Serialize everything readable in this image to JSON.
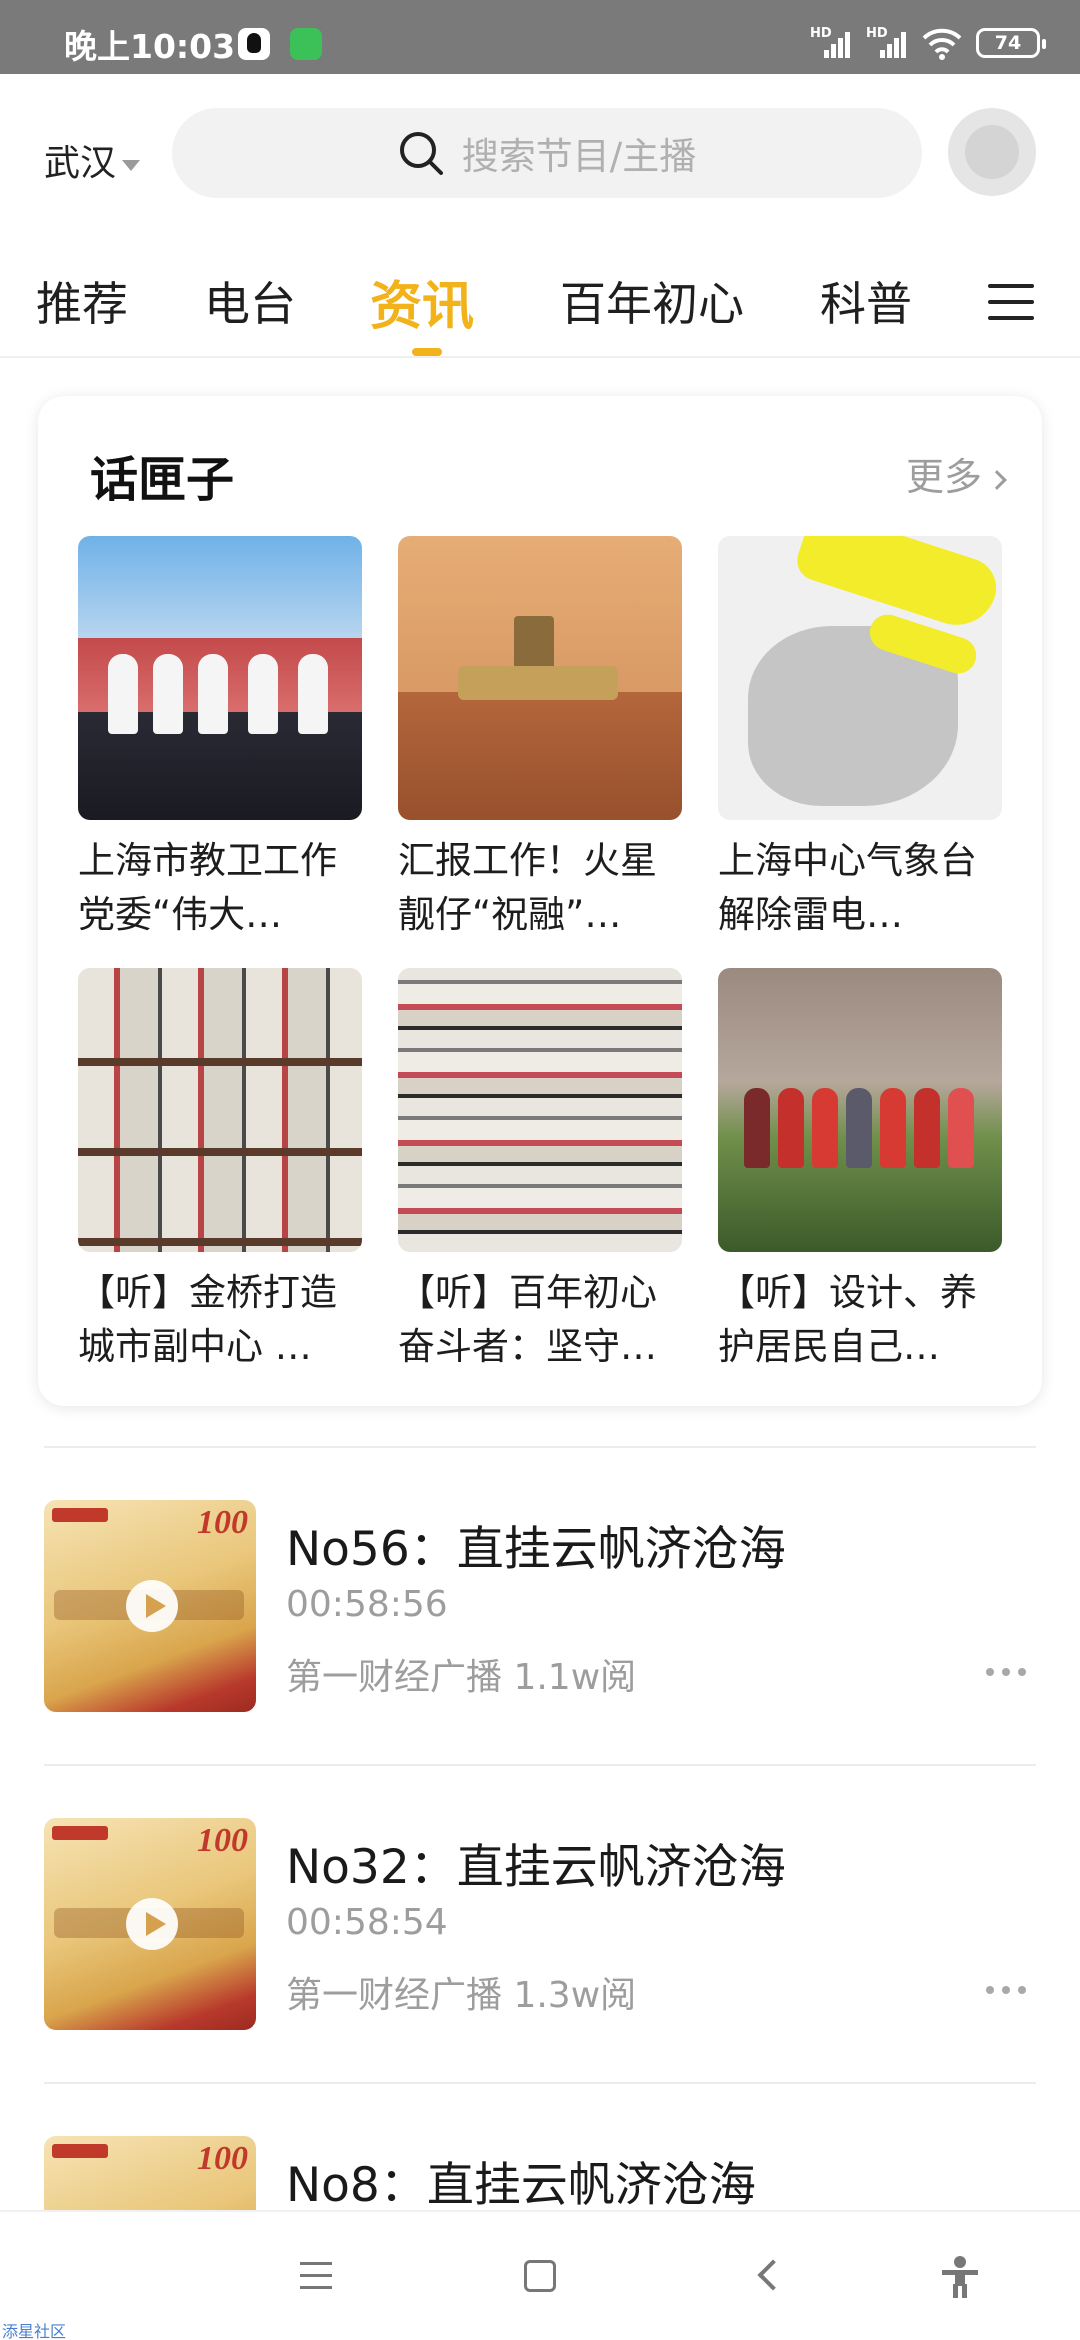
{
  "status_bar": {
    "time": "晚上10:03",
    "signal_label_1": "HD",
    "signal_label_2": "HD",
    "battery": "74"
  },
  "header": {
    "city": "武汉",
    "search_placeholder": "搜索节目/主播"
  },
  "tabs": [
    {
      "label": "推荐",
      "active": false
    },
    {
      "label": "电台",
      "active": false
    },
    {
      "label": "资讯",
      "active": true
    },
    {
      "label": "百年初心",
      "active": false
    },
    {
      "label": "科普",
      "active": false
    }
  ],
  "card": {
    "title": "话匣子",
    "more": "更多",
    "items": [
      {
        "caption": "上海市教卫工作党委“伟大…"
      },
      {
        "caption": "汇报工作！火星靓仔“祝融”…"
      },
      {
        "caption": "上海中心气象台解除雷电…"
      },
      {
        "caption": "【听】金桥打造城市副中心 …"
      },
      {
        "caption": "【听】百年初心奋斗者：坚守…"
      },
      {
        "caption": "【听】设计、养护居民自己…"
      }
    ]
  },
  "list": [
    {
      "title": "No56：直挂云帆济沧海",
      "duration": "00:58:56",
      "meta": "第一财经广播 1.1w阅",
      "badge": "100"
    },
    {
      "title": "No32：直挂云帆济沧海",
      "duration": "00:58:54",
      "meta": "第一财经广播 1.3w阅",
      "badge": "100"
    },
    {
      "title": "No8：直挂云帆济沧海",
      "duration": "",
      "meta": "",
      "badge": "100"
    }
  ],
  "watermark": "添星社区",
  "colors": {
    "accent": "#f2b21a",
    "status_bar": "#7a7a7a",
    "muted_text": "#9d9d9d"
  }
}
